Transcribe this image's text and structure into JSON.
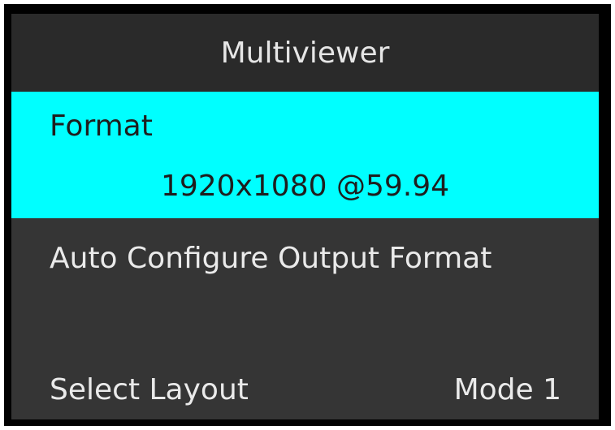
{
  "title": "Multiviewer",
  "menu": {
    "format": {
      "label": "Format",
      "value": "1920x1080 @59.94"
    },
    "auto_configure": {
      "label": "Auto Configure Output Format"
    },
    "select_layout": {
      "label": "Select Layout",
      "value": "Mode 1"
    }
  },
  "colors": {
    "highlight": "#00ffff",
    "background": "#353535",
    "title_bar": "#2a2a2a",
    "frame": "#000000"
  }
}
